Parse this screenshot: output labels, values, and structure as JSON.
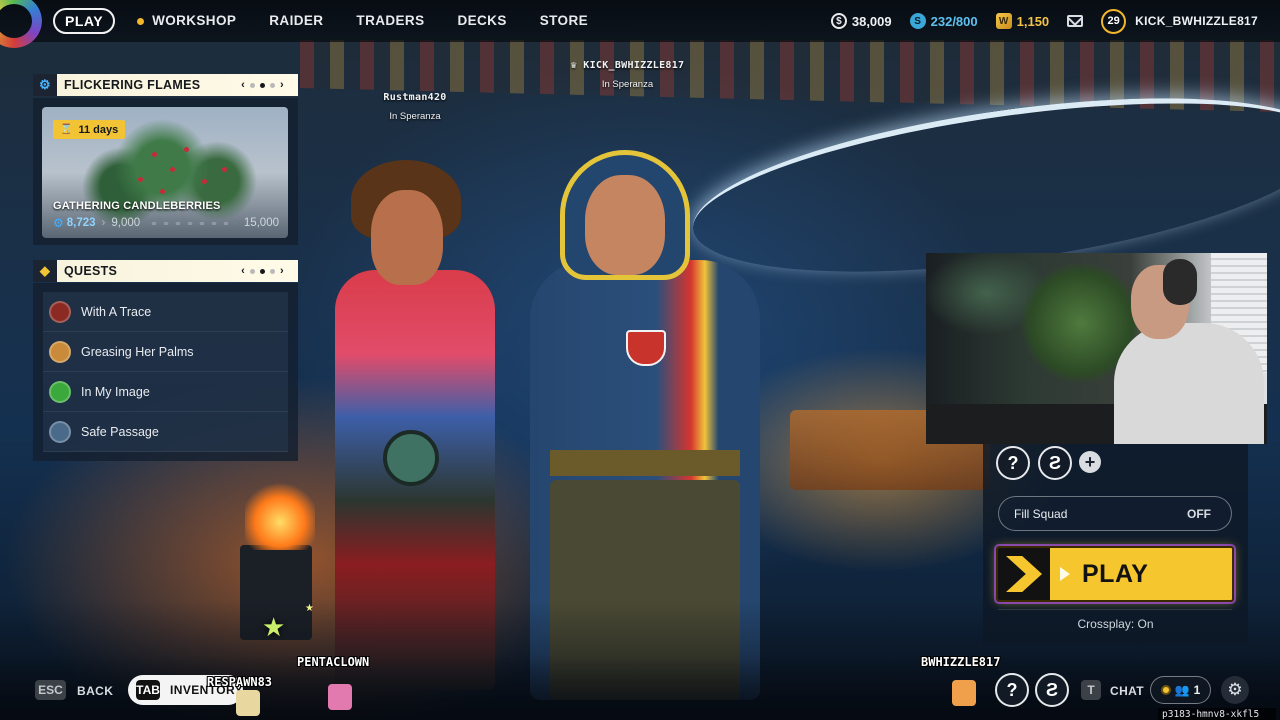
{
  "topbar": {
    "nav": {
      "play": "PLAY",
      "workshop": "WORKSHOP",
      "raider": "RAIDER",
      "traders": "TRADERS",
      "decks": "DECKS",
      "store": "STORE"
    },
    "currency": {
      "coins": "38,009",
      "credits": "232/800",
      "gold": "1,150"
    },
    "player": {
      "level": "29",
      "username": "KICK_BWHIZZLE817"
    }
  },
  "event": {
    "title": "FLICKERING FLAMES",
    "days_left": "11 days",
    "card_title": "GATHERING CANDLEBERRIES",
    "progress_current": "8,723",
    "progress_next": "9,000",
    "progress_max": "15,000",
    "page_total": 3,
    "page_current": 2
  },
  "quests": {
    "title": "QUESTS",
    "page_total": 3,
    "page_current": 2,
    "items": [
      {
        "label": "With A Trace"
      },
      {
        "label": "Greasing Her Palms"
      },
      {
        "label": "In My Image"
      },
      {
        "label": "Safe Passage"
      }
    ]
  },
  "players": [
    {
      "name": "Rustman420",
      "location": "In Speranza"
    },
    {
      "name": "KICK_BWHIZZLE817",
      "location": "In Speranza"
    }
  ],
  "squad": {
    "fill_squad_label": "Fill Squad",
    "fill_squad_value": "OFF",
    "play_label": "PLAY",
    "crossplay": "Crossplay: On"
  },
  "bottombar": {
    "esc_key": "ESC",
    "back_label": "BACK",
    "tab_key": "TAB",
    "inventory_label": "INVENTORY",
    "t_key": "T",
    "chat_label": "CHAT",
    "friends_count": "1",
    "build_id": "p3183-hmnv8-xkfl5"
  },
  "stream_overlay": {
    "names": [
      "RESPAWN83",
      "PENTACLOWN",
      "BWHIZZLE817"
    ]
  },
  "colors": {
    "accent_yellow": "#f6c62e",
    "credits_blue": "#5ec1ef",
    "gold": "#f3c34a",
    "panel_header_bg": "#fffbe8"
  },
  "icons": {
    "event": "gear-icon",
    "quests": "diamond-icon",
    "days": "hourglass-icon",
    "mail": "mail-icon",
    "settings": "settings-icon"
  }
}
